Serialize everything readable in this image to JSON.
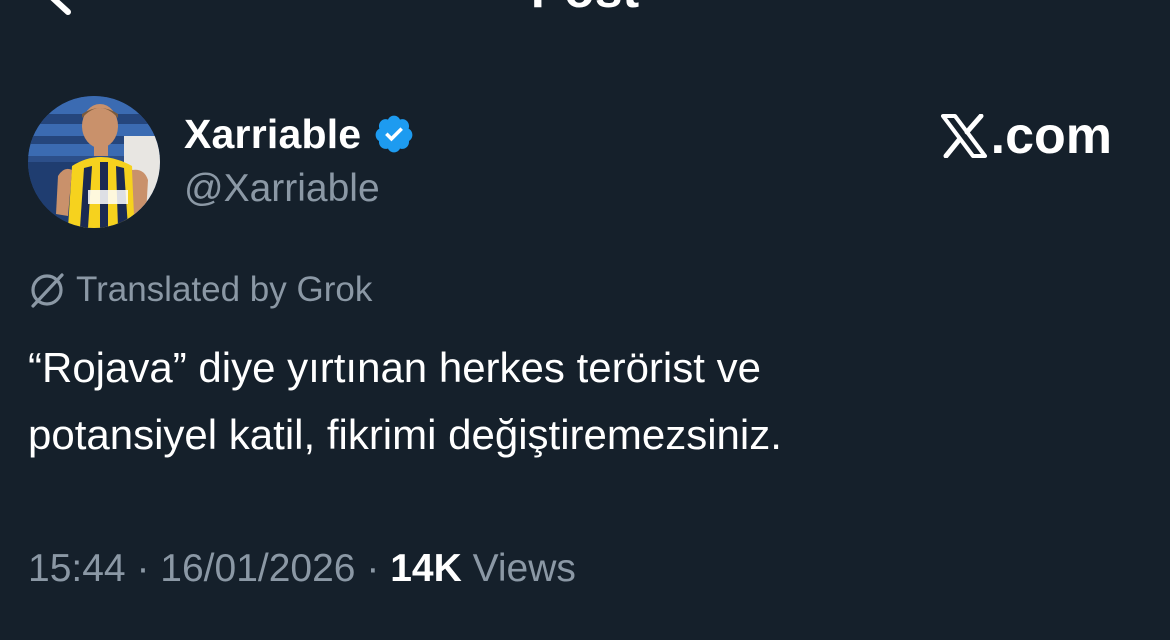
{
  "header": {
    "title": "Post",
    "back_icon": "chevron-left-icon"
  },
  "author": {
    "display_name": "Xarriable",
    "handle": "@Xarriable",
    "verified": true,
    "verified_color": "#1d9bf0",
    "avatar": "player-photo"
  },
  "brand": {
    "logo": "x-logo-icon",
    "suffix": ".com"
  },
  "translation": {
    "icon": "grok-icon",
    "label": "Translated by Grok"
  },
  "post": {
    "lines": [
      "“Rojava” diye yırtınan herkes terörist ve",
      "potansiyel katil, fikrimi değiştiremezsiniz."
    ]
  },
  "meta": {
    "time": "15:44",
    "sep1": "·",
    "date": "16/01/2026",
    "sep2": "·",
    "views_count": "14K",
    "views_label": "Views"
  },
  "colors": {
    "background": "#15202b",
    "primary_text": "#ffffff",
    "secondary_text": "#8b98a5",
    "accent": "#1d9bf0"
  }
}
